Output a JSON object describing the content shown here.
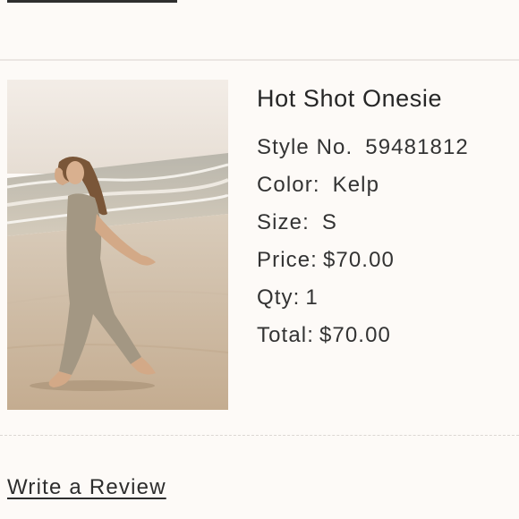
{
  "product": {
    "name": "Hot Shot Onesie",
    "image_alt": "photo of model walking on beach wearing jumpsuit",
    "style_label": "Style No.",
    "style_value": "59481812",
    "color_label": "Color:",
    "color_value": "Kelp",
    "size_label": "Size:",
    "size_value": "S",
    "price_label": "Price:",
    "price_value": "$70.00",
    "qty_label": "Qty:",
    "qty_value": "1",
    "total_label": "Total:",
    "total_value": "$70.00"
  },
  "actions": {
    "write_review": "Write a Review"
  },
  "colors": {
    "background": "#fdfaf7",
    "text": "#2a2a2a",
    "divider": "#ebe6e2",
    "dashed_divider": "#dcd7d3"
  }
}
